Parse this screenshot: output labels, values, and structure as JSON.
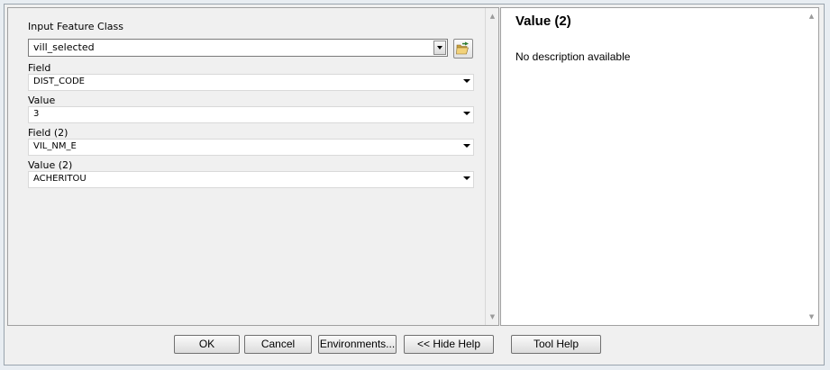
{
  "form": {
    "fields": [
      {
        "label": "Input Feature Class",
        "value": "vill_selected"
      },
      {
        "label": "Field",
        "value": "DIST_CODE"
      },
      {
        "label": "Value",
        "value": "3"
      },
      {
        "label": "Field (2)",
        "value": "VIL_NM_E"
      },
      {
        "label": "Value (2)",
        "value": "ACHERITOU"
      }
    ],
    "browse_icon": "open-folder-icon"
  },
  "help": {
    "title": "Value (2)",
    "description": "No description available"
  },
  "buttons": {
    "ok": "OK",
    "cancel": "Cancel",
    "environments": "Environments...",
    "hide_help": "<< Hide Help",
    "tool_help": "Tool Help"
  }
}
